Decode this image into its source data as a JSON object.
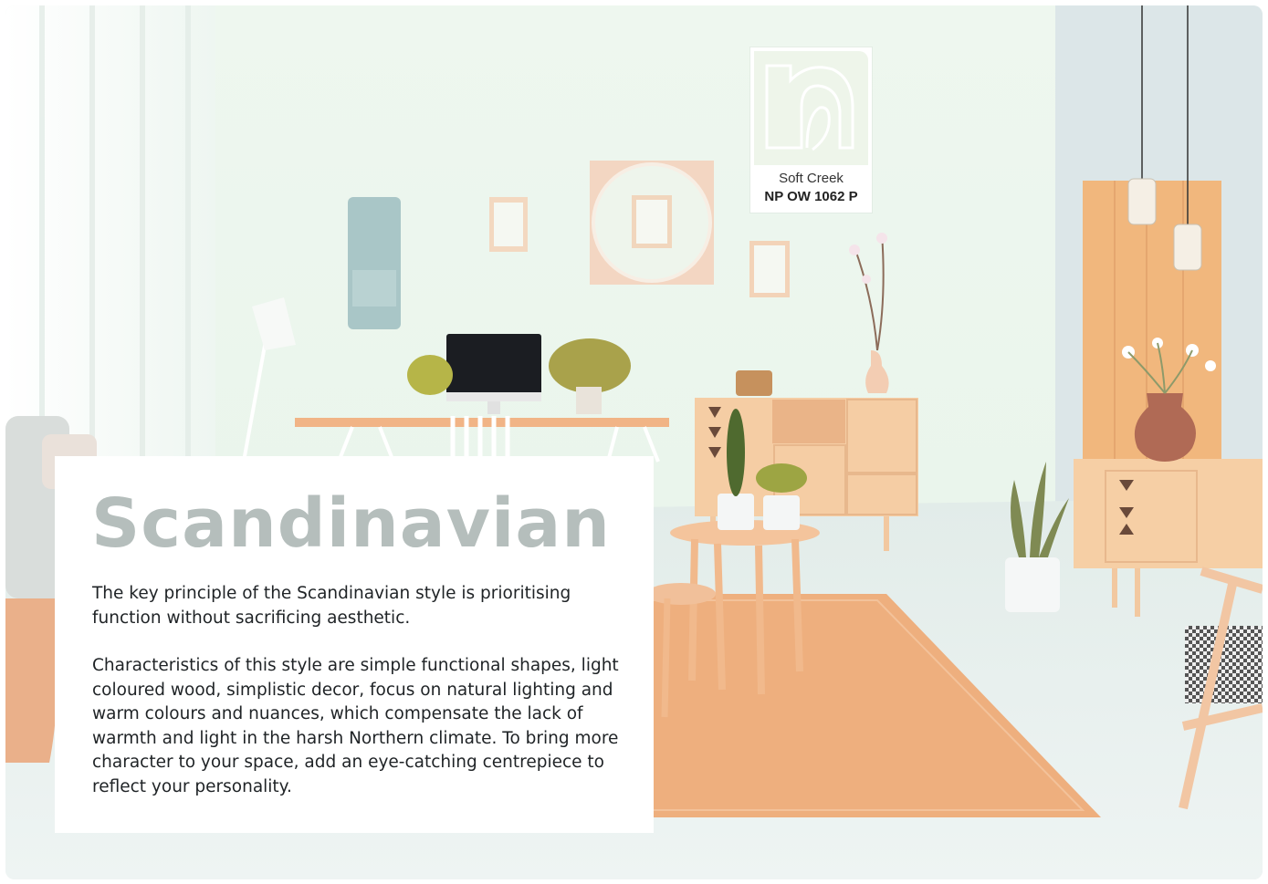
{
  "heading": "Scandinavian",
  "paragraphs": [
    "The key principle of the Scandinavian style is prioritising function without sacrificing aesthetic.",
    "Characteristics of this style are simple functional shapes, light coloured wood, simplistic decor, focus on natural lighting and warm colours and nuances, which compensate the lack of warmth and light in the harsh Northern climate. To bring more character to your space, add an eye-catching centrepiece to reflect your personality."
  ],
  "swatch": {
    "name": "Soft Creek",
    "code": "NP OW 1062 P",
    "color": "#eef5ea",
    "logo_icon": "n-letter-logo-icon"
  },
  "colors": {
    "wall": "#ecf6ed",
    "wood": "#f3c79a",
    "rug": "#eeae7d",
    "heading_gray": "#b5bebc",
    "text": "#1f2326"
  }
}
